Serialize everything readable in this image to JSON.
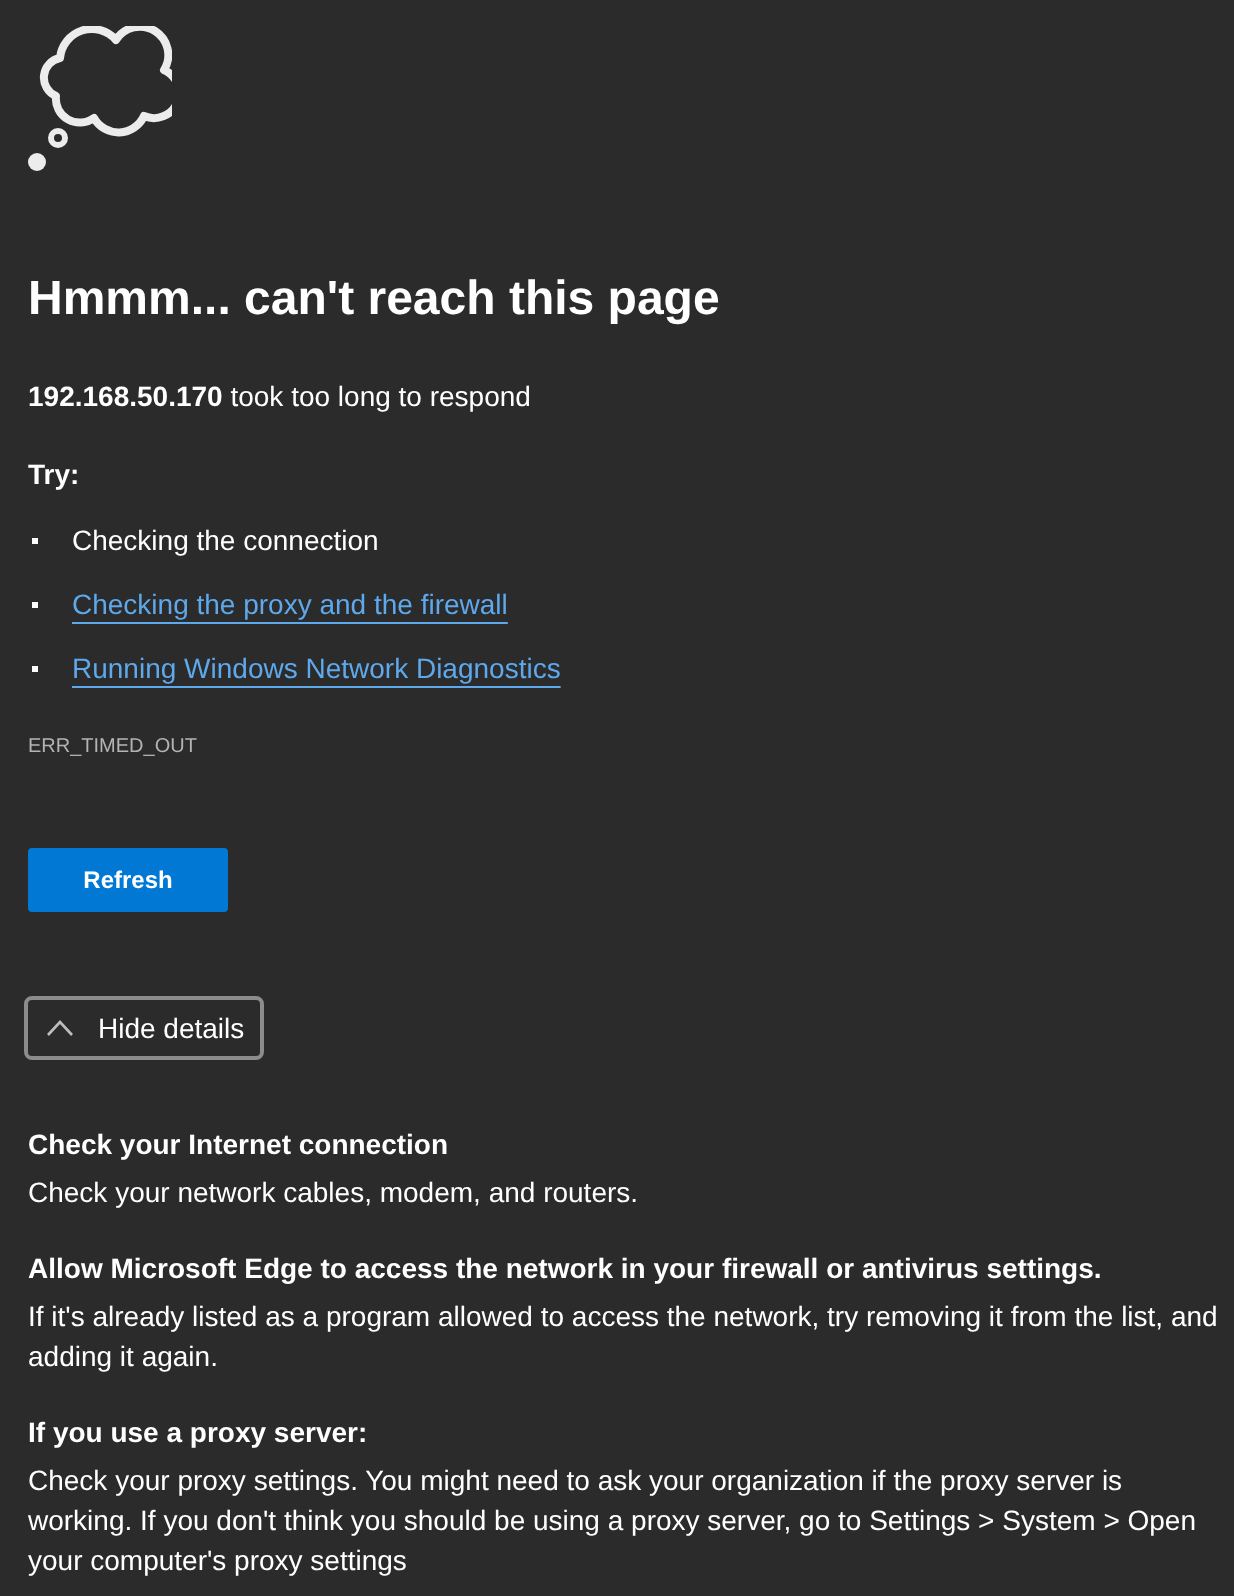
{
  "page": {
    "title": "Hmmm... can't reach this page",
    "message": "**192.168.50.170** took too long to respond"
  },
  "suggestions": {
    "heading": "Try:",
    "items": [
      {
        "kind": "text",
        "text": "Checking the connection"
      },
      {
        "kind": "link",
        "text": "Checking the proxy and the firewall"
      },
      {
        "kind": "link",
        "text": "Running Windows Network Diagnostics"
      }
    ]
  },
  "error_code": "ERR_TIMED_OUT",
  "refresh_button": "Refresh",
  "details_toggle": {
    "label": "Hide details",
    "expanded": true
  },
  "details": [
    {
      "heading": "Check your Internet connection",
      "text": "Check your network cables, modem, and routers."
    },
    {
      "heading": "Allow Microsoft Edge to access the network in your firewall or antivirus settings.",
      "text": "If it's already listed as a program allowed to access the network, try removing it from the list, and adding it again."
    },
    {
      "heading": "If you use a proxy server:",
      "text": "Check your proxy settings. You might need to ask your organization if the proxy server is working. If you don't think you should be using a proxy server, go to Settings > System > Open your computer's proxy settings"
    }
  ]
}
